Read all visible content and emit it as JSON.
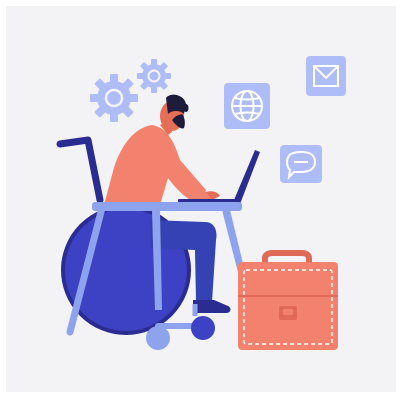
{
  "illustration": {
    "icons": [
      {
        "name": "gear-icon"
      },
      {
        "name": "globe-icon"
      },
      {
        "name": "mail-icon"
      },
      {
        "name": "chat-bubble-icon"
      }
    ]
  },
  "colors": {
    "canvas": "#f3f3f5",
    "icon_tile": "#aebdf7",
    "icon_stroke": "#ffffff",
    "gear": "#aebdf7",
    "wheelchair_dark": "#2b2c91",
    "wheelchair_wheel": "#3d41c4",
    "wheelchair_light": "#8ea3ee",
    "desk": "#8ea3ee",
    "shirt": "#f2826d",
    "skin": "#e56e57",
    "hair": "#1f1b3b",
    "pants": "#3442b3",
    "shoe": "#2b2c91",
    "laptop": "#2b2c91",
    "briefcase": "#f2826d",
    "briefcase_dark": "#e06a57",
    "briefcase_stitch": "#ffffff"
  }
}
